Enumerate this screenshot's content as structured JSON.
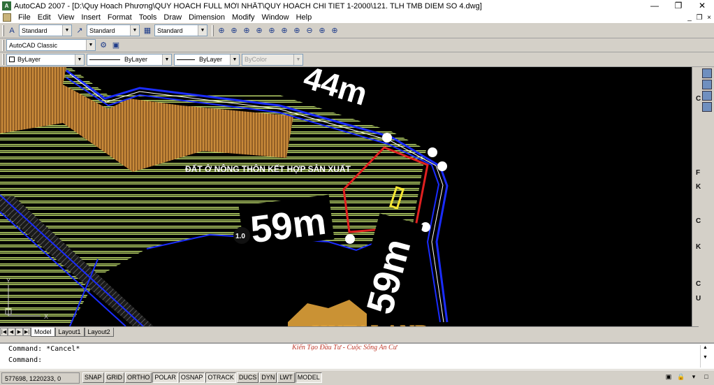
{
  "window": {
    "app_icon": "A",
    "title": "AutoCAD 2007 - [D:\\Quy Hoach Phương\\QUY HOACH  FULL MỚI NHẤT\\QUY HOACH CHI TIET 1-2000\\121. TLH TMB DIEM SO 4.dwg]",
    "minimize": "—",
    "restore": "❐",
    "close": "✕"
  },
  "menu": {
    "items": [
      "File",
      "Edit",
      "View",
      "Insert",
      "Format",
      "Tools",
      "Draw",
      "Dimension",
      "Modify",
      "Window",
      "Help"
    ],
    "mdi_min": "_",
    "mdi_restore": "❐",
    "mdi_close": "×"
  },
  "toolbar1": {
    "text_style": "Standard",
    "dim_style": "Standard",
    "table_style": "Standard"
  },
  "toolbar2": {
    "workspace": "AutoCAD Classic"
  },
  "toolbar3": {
    "layer_color": "ByLayer",
    "linetype": "ByLayer",
    "lineweight": "ByLayer",
    "plot_style": "ByColor"
  },
  "drawing": {
    "dim_44": "44m",
    "dim_59_left": "59m",
    "dim_59_right": "59m",
    "land_label": "ĐẤT Ở NÔNG THÔN KẾT HỢP SẢN XUẤT",
    "marker_label": "1.0",
    "axis_x": "X",
    "axis_y": "Y",
    "logo_main": "HUTALAND",
    "logo_tagline": "Kiến Tạo Đầu Tư - Cuộc Sống An Cư"
  },
  "right_panel": {
    "letters": [
      "C",
      "F",
      "K",
      "C",
      "K",
      "C",
      "U"
    ]
  },
  "layout_tabs": [
    "Model",
    "Layout1",
    "Layout2"
  ],
  "command": {
    "history": "Command: *Cancel*",
    "prompt": "Command:"
  },
  "status": {
    "coordinates": "577698, 1220233, 0",
    "buttons": [
      "SNAP",
      "GRID",
      "ORTHO",
      "POLAR",
      "OSNAP",
      "OTRACK",
      "DUCS",
      "DYN",
      "LWT",
      "MODEL"
    ]
  },
  "colors": {
    "hatch_green": "#b8d468",
    "boundary_blue": "#1a2cff",
    "wood_brown": "#c98a3a",
    "plot_red": "#e02020",
    "logo_gold": "#e0a23a"
  }
}
